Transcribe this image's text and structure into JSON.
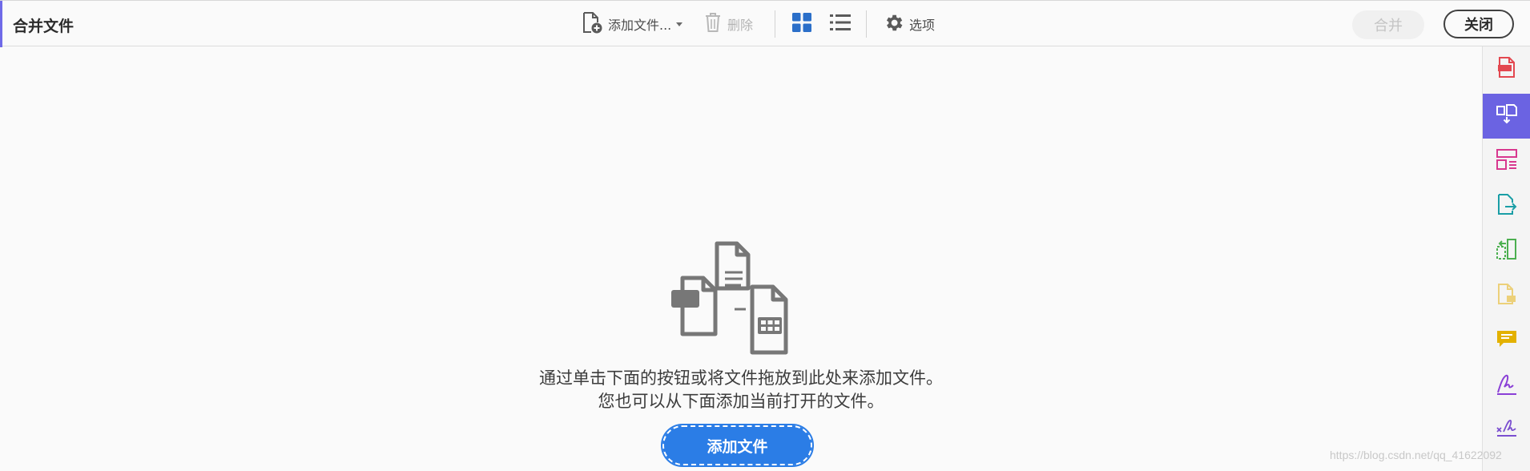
{
  "window": {
    "title": "合并文件"
  },
  "toolbar": {
    "add_files_label": "添加文件...",
    "delete_label": "删除",
    "options_label": "选项",
    "merge_label": "合并",
    "close_label": "关闭"
  },
  "main": {
    "message_line1": "通过单击下面的按钮或将文件拖放到此处来添加文件。",
    "message_line2": "您也可以从下面添加当前打开的文件。",
    "add_button_label": "添加文件"
  },
  "watermark": "https://blog.csdn.net/qq_41622092",
  "colors": {
    "accent": "#6b63e2",
    "primary_button": "#2b7de6",
    "grid_view_icon": "#2b6fc9"
  },
  "rail_items": [
    {
      "icon": "create-pdf-icon",
      "color": "#e34850"
    },
    {
      "icon": "combine-files-icon",
      "color": "#ffffff",
      "active": true
    },
    {
      "icon": "organize-pages-icon",
      "color": "#d8388f"
    },
    {
      "icon": "export-pdf-icon",
      "color": "#1a9ea6"
    },
    {
      "icon": "edit-pdf-icon",
      "color": "#4caf50"
    },
    {
      "icon": "comment-file-icon",
      "color": "#e9c75a"
    },
    {
      "icon": "comment-icon",
      "color": "#e3b100"
    },
    {
      "icon": "fill-sign-icon",
      "color": "#8a3fd6"
    },
    {
      "icon": "signature-icon",
      "color": "#7b4fd0"
    }
  ]
}
